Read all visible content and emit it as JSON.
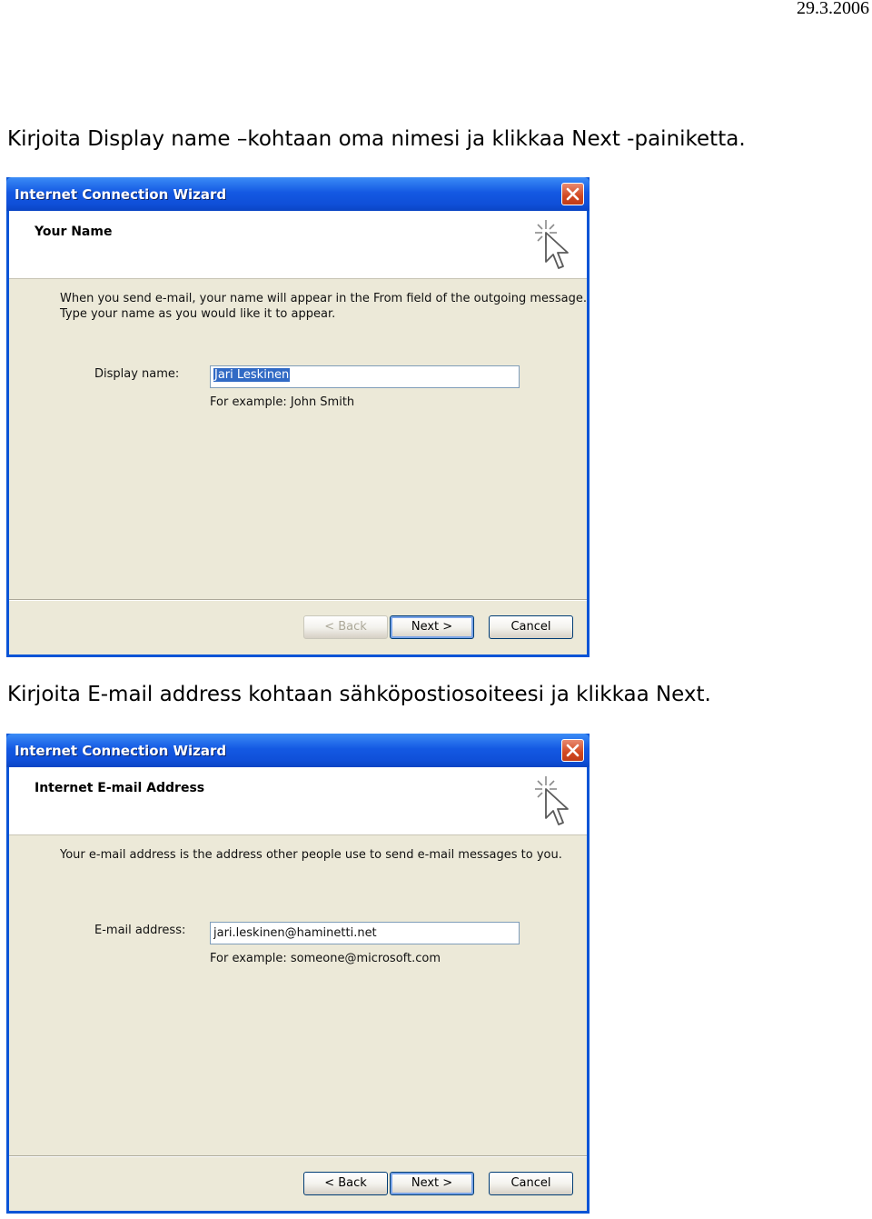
{
  "page": {
    "date": "29.3.2006",
    "instruction1": "Kirjoita Display name –kohtaan oma nimesi ja klikkaa Next -painiketta.",
    "instruction2": "Kirjoita E-mail address kohtaan sähköpostiosoiteesi ja klikkaa Next."
  },
  "wizard1": {
    "title": "Internet Connection Wizard",
    "header": "Your Name",
    "desc_line1": "When you send e-mail, your name will appear in the From field of the outgoing message.",
    "desc_line2": "Type your name as you would like it to appear.",
    "field_label": "Display name:",
    "field_value": "Jari Leskinen",
    "field_selected": true,
    "example": "For example: John Smith",
    "back_label": "< Back",
    "back_enabled": false,
    "next_label": "Next >",
    "cancel_label": "Cancel"
  },
  "wizard2": {
    "title": "Internet Connection Wizard",
    "header": "Internet E-mail Address",
    "desc_line1": "Your e-mail address is the address other people use to send e-mail messages to you.",
    "field_label": "E-mail address:",
    "field_value": "jari.leskinen@haminetti.net",
    "field_selected": false,
    "example": "For example: someone@microsoft.com",
    "back_label": "< Back",
    "back_enabled": true,
    "next_label": "Next >",
    "cancel_label": "Cancel"
  },
  "colors": {
    "titlebar": "#0a54d6",
    "dialog_body": "#ece9d8",
    "selection": "#316ac5",
    "close_button": "#d24820"
  },
  "icons": [
    "close-icon",
    "wizard-cursor-icon"
  ]
}
